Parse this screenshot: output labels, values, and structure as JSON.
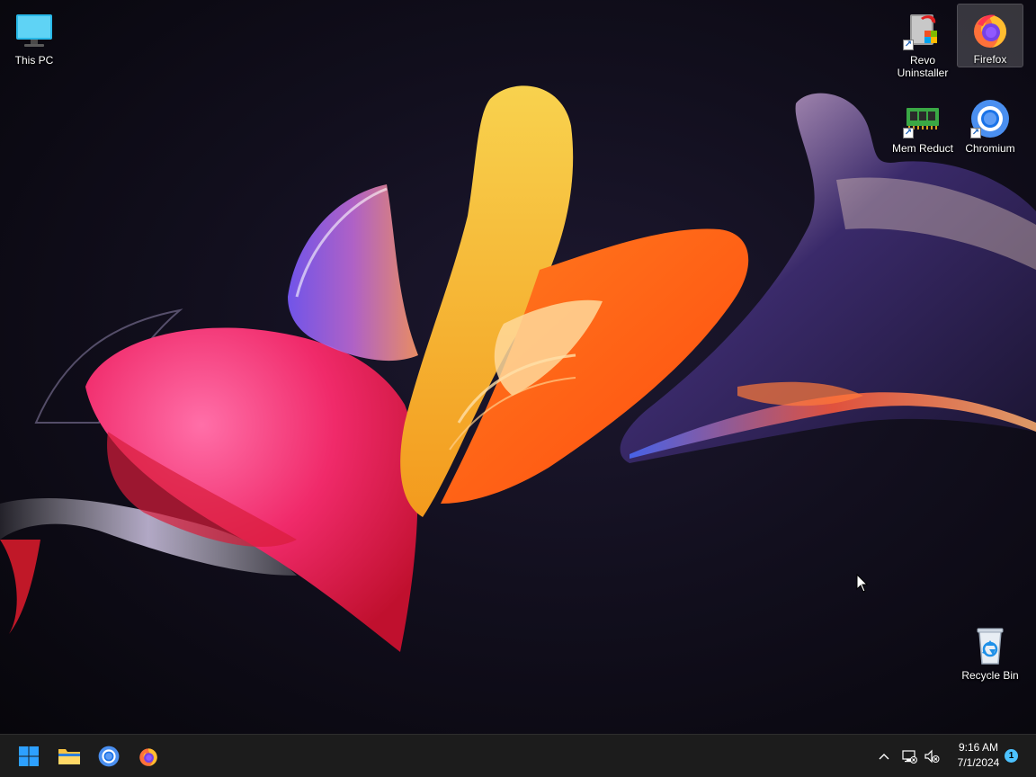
{
  "desktop": {
    "icons": [
      {
        "label": "This PC",
        "icon": "monitor-icon"
      },
      {
        "label": "Revo Uninstaller",
        "icon": "revo-uninstaller-icon"
      },
      {
        "label": "Firefox",
        "icon": "firefox-icon",
        "selected": true
      },
      {
        "label": "Mem Reduct",
        "icon": "mem-reduct-icon"
      },
      {
        "label": "Chromium",
        "icon": "chromium-icon"
      },
      {
        "label": "Recycle Bin",
        "icon": "recycle-bin-icon"
      }
    ]
  },
  "taskbar": {
    "pinned": [
      {
        "name": "start",
        "icon": "windows-start-icon"
      },
      {
        "name": "file-explorer",
        "icon": "folder-icon"
      },
      {
        "name": "chromium",
        "icon": "chromium-icon"
      },
      {
        "name": "firefox",
        "icon": "firefox-icon"
      }
    ],
    "tray": {
      "overflow_icon": "chevron-up-icon",
      "network_icon": "network-disconnected-icon",
      "volume_icon": "volume-muted-icon",
      "time": "9:16 AM",
      "date": "7/1/2024",
      "notification_count": "1"
    }
  },
  "colors": {
    "taskbar_bg": "#1c1c1c",
    "accent": "#4cc2ff",
    "windows_blue": "#0a84d8"
  }
}
